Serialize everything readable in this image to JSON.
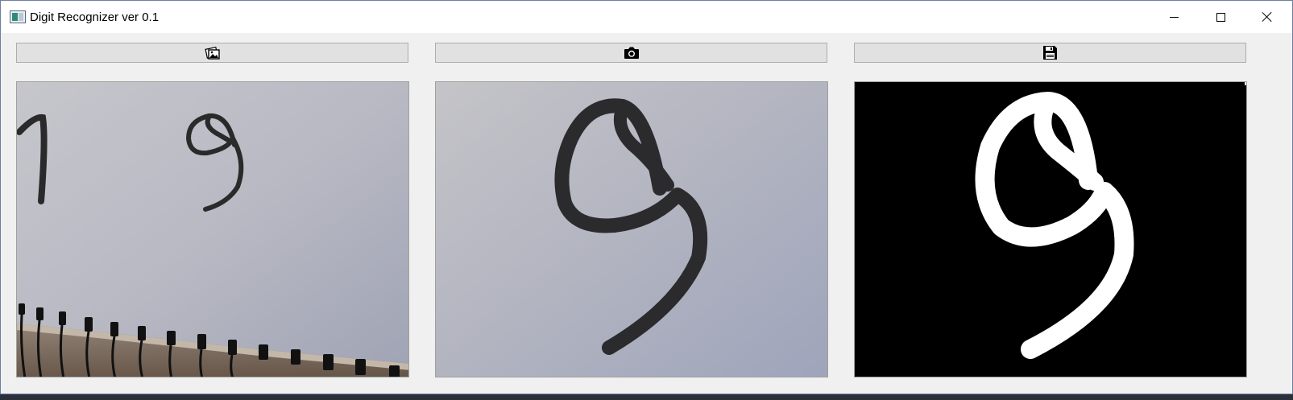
{
  "window": {
    "title": "Digit Recognizer ver 0.1"
  },
  "toolbar": {
    "buttons": [
      {
        "name": "open-image",
        "icon": "open-image-icon"
      },
      {
        "name": "camera",
        "icon": "camera-icon"
      },
      {
        "name": "save",
        "icon": "save-disk-icon"
      }
    ]
  },
  "panels": [
    {
      "name": "webcam-view",
      "content": "camera frame of notebook page with handwritten digits"
    },
    {
      "name": "cropped-digit-view",
      "content": "cropped handwritten digit"
    },
    {
      "name": "binarized-digit-view",
      "content": "thresholded white digit on black"
    }
  ],
  "colors": {
    "window_bg": "#f0f0f0",
    "button_bg": "#e1e1e1",
    "button_border": "#adadad",
    "ink": "#2a2a2a",
    "binary_fg": "#ffffff",
    "binary_bg": "#000000"
  }
}
